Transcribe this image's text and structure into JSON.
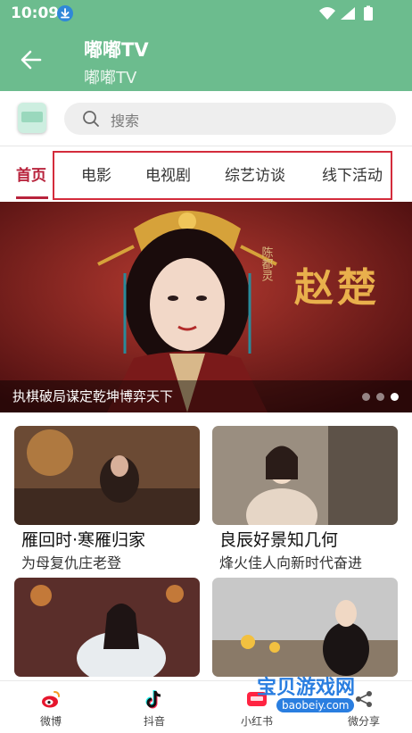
{
  "status_bar": {
    "time": "10:09"
  },
  "app_bar": {
    "title": "嘟嘟TV",
    "subtitle": "嘟嘟TV"
  },
  "search": {
    "placeholder": "搜索"
  },
  "tabs": [
    {
      "label": "首页",
      "active": true
    },
    {
      "label": "电影",
      "active": false
    },
    {
      "label": "电视剧",
      "active": false
    },
    {
      "label": "综艺访谈",
      "active": false
    },
    {
      "label": "线下活动",
      "active": false
    }
  ],
  "banner": {
    "caption": "执棋破局谋定乾坤博弈天下",
    "calligraphy": "赵楚",
    "slide_count": 3,
    "active_slide": 3
  },
  "cards": [
    {
      "title": "雁回时·寒雁归家",
      "subtitle": "为母复仇庄老登"
    },
    {
      "title": "良辰好景知几何",
      "subtitle": "烽火佳人向新时代奋进"
    },
    {
      "title": "",
      "subtitle": ""
    },
    {
      "title": "",
      "subtitle": ""
    }
  ],
  "bottom_nav": [
    {
      "label": "微博",
      "icon": "weibo-icon"
    },
    {
      "label": "抖音",
      "icon": "douyin-icon"
    },
    {
      "label": "小红书",
      "icon": "xiaohongshu-icon"
    },
    {
      "label": "微分享",
      "icon": "share-icon"
    }
  ],
  "watermark": {
    "text": "宝贝游戏网",
    "url": "baobeiy.com"
  },
  "colors": {
    "appbar": "#6cbc8e",
    "accent": "#b8233c",
    "highlight": "#d42c3c"
  }
}
